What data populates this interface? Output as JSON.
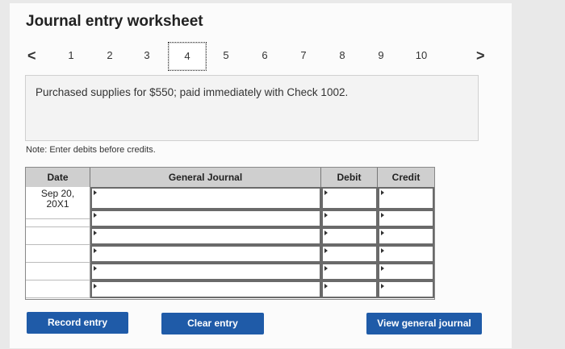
{
  "title": "Journal entry worksheet",
  "pager": {
    "prev_icon": "chevron-left-icon",
    "next_icon": "chevron-right-icon",
    "prev_glyph": "<",
    "next_glyph": ">",
    "pages": [
      "1",
      "2",
      "3",
      "4",
      "5",
      "6",
      "7",
      "8",
      "9",
      "10"
    ],
    "current": "4"
  },
  "question": "Purchased supplies for $550; paid immediately with Check 1002.",
  "note": "Note: Enter debits before credits.",
  "journal": {
    "headers": {
      "date": "Date",
      "account": "General Journal",
      "debit": "Debit",
      "credit": "Credit"
    },
    "date_value": "Sep 20, 20X1",
    "date_line1": "Sep 20,",
    "date_line2": "20X1",
    "row_count": 6
  },
  "buttons": {
    "record": "Record entry",
    "clear": "Clear entry",
    "view": "View general journal"
  },
  "colors": {
    "button": "#1f5ba8",
    "header": "#cfcfcf"
  }
}
